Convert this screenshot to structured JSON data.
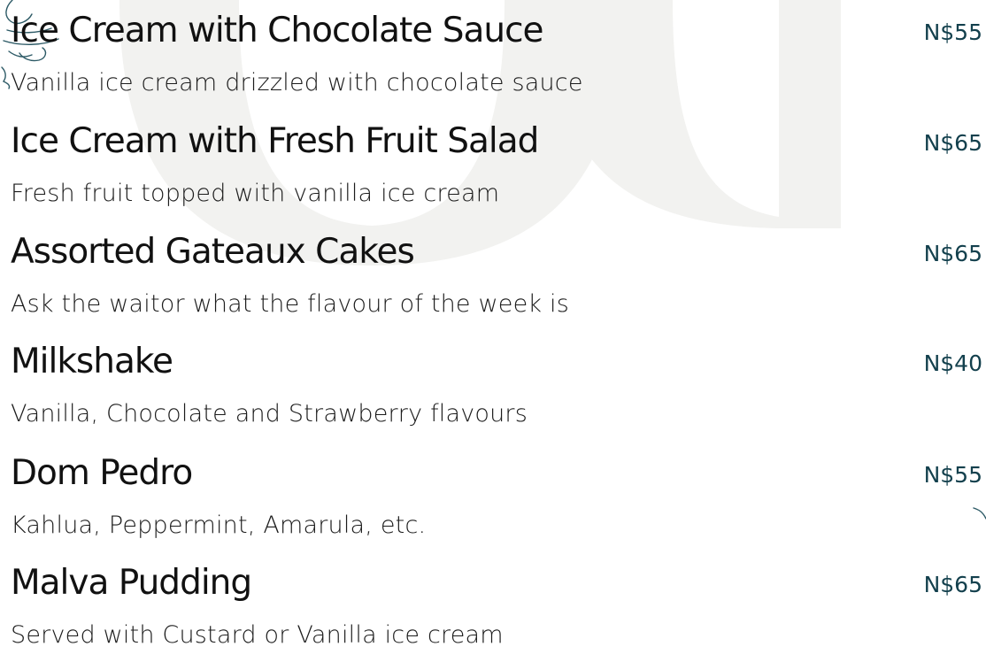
{
  "menu": {
    "items": [
      {
        "name": "Ice Cream with Chocolate Sauce",
        "description": "Vanilla ice cream drizzled with chocolate sauce",
        "price": "N$55"
      },
      {
        "name": "Ice Cream with Fresh Fruit Salad",
        "description": "Fresh fruit topped with vanilla ice cream",
        "price": "N$65"
      },
      {
        "name": "Assorted Gateaux Cakes",
        "description": "Ask the waitor what the flavour of the week is",
        "price": "N$65"
      },
      {
        "name": "Milkshake",
        "description": "Vanilla, Chocolate and Strawberry flavours",
        "price": "N$40"
      },
      {
        "name": "Dom Pedro",
        "description": "Kahlua, Peppermint, Amarula, etc.",
        "price": "N$55"
      },
      {
        "name": "Malva Pudding",
        "description": "Served with Custard or Vanilla ice cream",
        "price": "N$65"
      }
    ]
  },
  "decor": {
    "watermark_color": "#f2f2f0",
    "ornament_color": "#2d5a66",
    "price_color": "#13404d"
  }
}
